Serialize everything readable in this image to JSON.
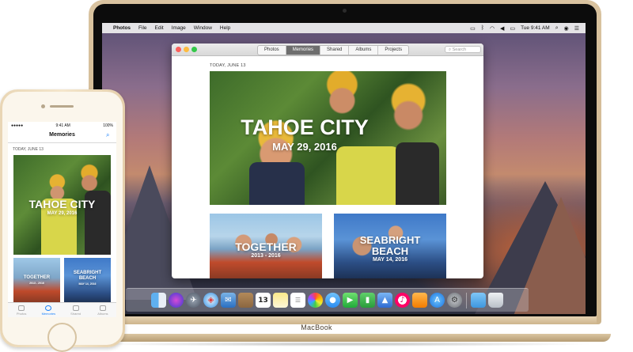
{
  "mac_menubar": {
    "apple": "",
    "items": [
      "Photos",
      "File",
      "Edit",
      "Image",
      "Window",
      "Help"
    ],
    "clock": "Tue 9:41 AM"
  },
  "photos_window": {
    "tabs": [
      "Photos",
      "Memories",
      "Shared",
      "Albums",
      "Projects"
    ],
    "active_tab": "Memories",
    "search_placeholder": "Search",
    "date_label": "TODAY, JUNE 13",
    "hero": {
      "title": "TAHOE CITY",
      "subtitle": "MAY 29, 2016"
    },
    "card1": {
      "title": "TOGETHER",
      "subtitle": "2013 - 2016"
    },
    "card2": {
      "title_line1": "SEABRIGHT",
      "title_line2": "BEACH",
      "subtitle": "MAY 14, 2016"
    }
  },
  "dock": {
    "apps": [
      "finder-icon",
      "siri-icon",
      "launchpad-icon",
      "safari-icon",
      "mail-icon",
      "contacts-icon",
      "calendar-icon",
      "notes-icon",
      "reminders-icon",
      "photos-icon",
      "messages-icon",
      "facetime-icon",
      "numbers-icon",
      "keynote-icon",
      "itunes-icon",
      "ibooks-icon",
      "app-store-icon",
      "system-preferences-icon",
      "downloads-folder-icon",
      "trash-icon"
    ],
    "calendar_day": "13"
  },
  "macbook_label": "MacBook",
  "iphone": {
    "status": {
      "carrier": "●●●●● ",
      "time": "9:41 AM",
      "battery": "100%"
    },
    "nav_title": "Memories",
    "date_label": "TODAY, JUNE 13",
    "hero": {
      "title": "TAHOE CITY",
      "subtitle": "MAY 29, 2016"
    },
    "card1": {
      "title": "TOGETHER",
      "subtitle": "2013 - 2016"
    },
    "card2": {
      "title_line1": "SEABRIGHT",
      "title_line2": "BEACH",
      "subtitle": "MAY 14, 2016"
    },
    "tabbar": [
      "Photos",
      "Memories",
      "Shared",
      "Albums"
    ],
    "active_tab": "Memories"
  },
  "colors": {
    "accent_blue": "#1a82fb",
    "macbook_gold": "#d9c3a0",
    "traffic_red": "#fc605b",
    "traffic_yellow": "#fdbc40",
    "traffic_green": "#34c84a"
  }
}
